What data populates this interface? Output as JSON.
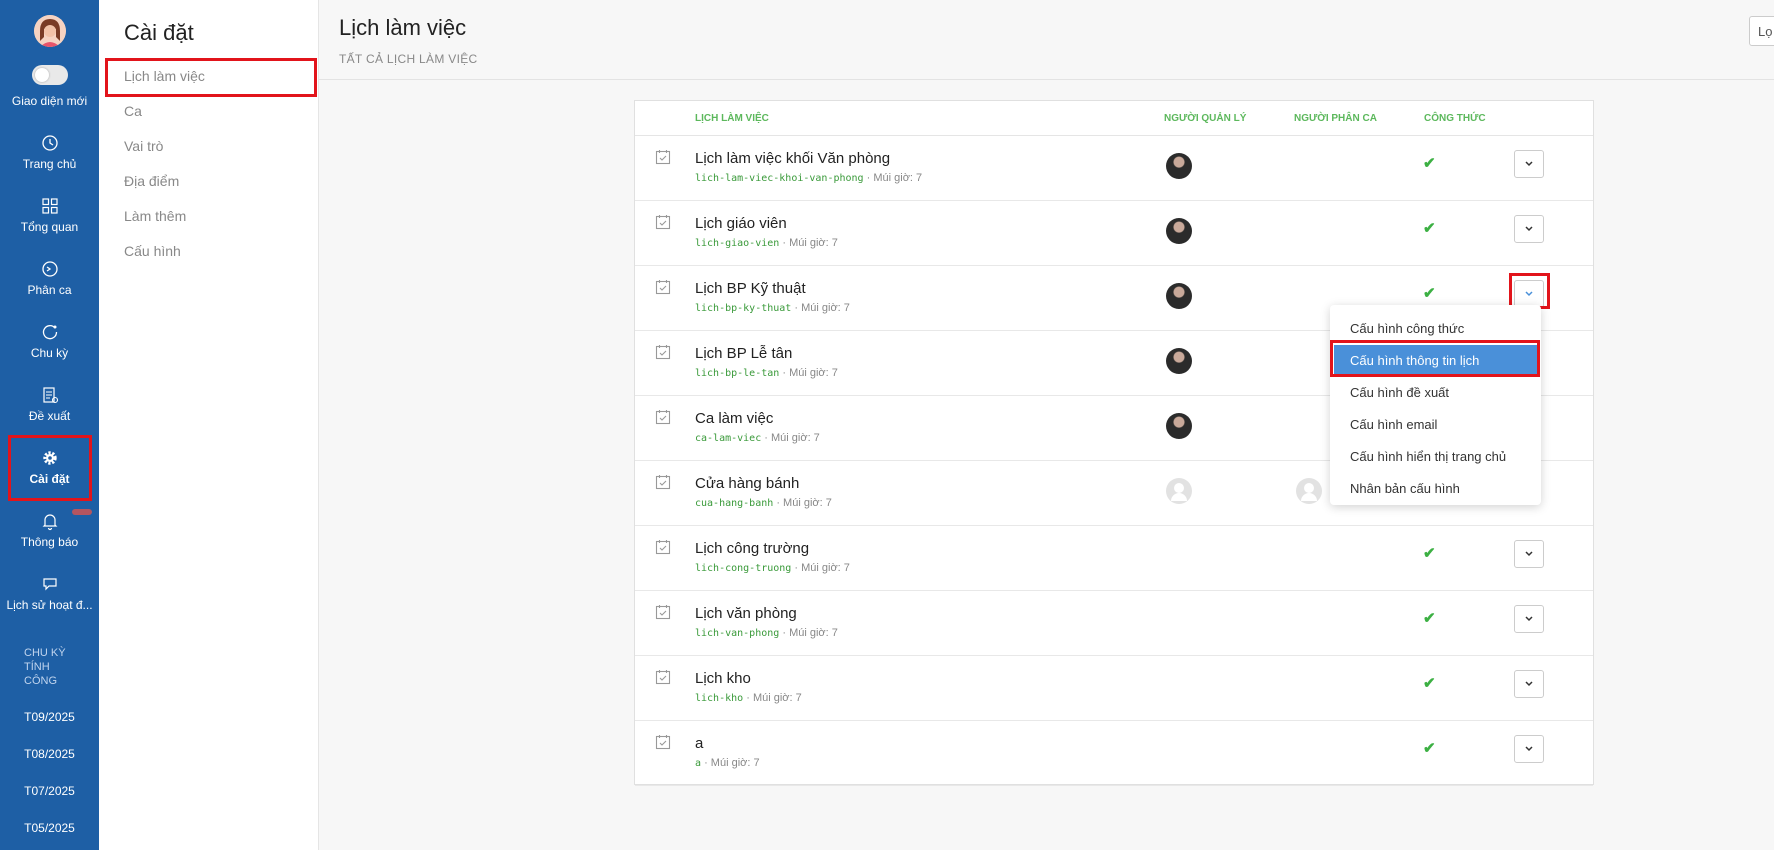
{
  "nav": {
    "toggle_label": "Giao diện mới",
    "items": [
      {
        "label": "Trang chủ",
        "icon": "clock-icon"
      },
      {
        "label": "Tổng quan",
        "icon": "grid-icon"
      },
      {
        "label": "Phân ca",
        "icon": "clock-circle-icon"
      },
      {
        "label": "Chu kỳ",
        "icon": "refresh-icon"
      },
      {
        "label": "Đề xuất",
        "icon": "document-icon"
      },
      {
        "label": "Cài đặt",
        "icon": "gear-icon"
      },
      {
        "label": "Thông báo",
        "icon": "bell-icon"
      },
      {
        "label": "Lịch sử hoạt đ...",
        "icon": "chat-icon"
      }
    ],
    "cycle_title": "CHU KỲ TÍNH CÔNG",
    "cycles": [
      "T09/2025",
      "T08/2025",
      "T07/2025",
      "T05/2025"
    ]
  },
  "settings": {
    "title": "Cài đặt",
    "menu": [
      "Lịch làm việc",
      "Ca",
      "Vai trò",
      "Địa điểm",
      "Làm thêm",
      "Cấu hình"
    ]
  },
  "header": {
    "title": "Lịch làm việc",
    "subtitle": "TẤT CẢ LỊCH LÀM VIỆC",
    "top_button": "Lọ"
  },
  "table": {
    "columns": [
      "LỊCH LÀM VIỆC",
      "NGƯỜI QUẢN LÝ",
      "NGƯỜI PHÂN CA",
      "CÔNG THỨC"
    ],
    "rows": [
      {
        "name": "Lịch làm việc khối Văn phòng",
        "slug": "lich-lam-viec-khoi-van-phong",
        "tz": " · Múi giờ: 7",
        "manager": "photo",
        "formula": "✔"
      },
      {
        "name": "Lịch giáo viên",
        "slug": "lich-giao-vien",
        "tz": " · Múi giờ: 7",
        "manager": "photo",
        "formula": "✔"
      },
      {
        "name": "Lịch BP Kỹ thuật",
        "slug": "lich-bp-ky-thuat",
        "tz": " · Múi giờ: 7",
        "manager": "photo",
        "formula": "✔"
      },
      {
        "name": "Lịch BP Lễ tân",
        "slug": "lich-bp-le-tan",
        "tz": " · Múi giờ: 7",
        "manager": "photo",
        "formula": ""
      },
      {
        "name": "Ca làm việc",
        "slug": "ca-lam-viec",
        "tz": " · Múi giờ: 7",
        "manager": "photo",
        "formula": ""
      },
      {
        "name": "Cửa hàng bánh",
        "slug": "cua-hang-banh",
        "tz": " · Múi giờ: 7",
        "manager": "blank",
        "formula": ""
      },
      {
        "name": "Lịch công trường",
        "slug": "lich-cong-truong",
        "tz": " · Múi giờ: 7",
        "manager": "",
        "formula": "✔"
      },
      {
        "name": "Lịch văn phòng",
        "slug": "lich-van-phong",
        "tz": " · Múi giờ: 7",
        "manager": "",
        "formula": "✔"
      },
      {
        "name": "Lịch kho",
        "slug": "lich-kho",
        "tz": " · Múi giờ: 7",
        "manager": "",
        "formula": "✔"
      },
      {
        "name": "a",
        "slug": "a",
        "tz": " · Múi giờ: 7",
        "manager": "",
        "formula": "✔"
      }
    ]
  },
  "dropdown": {
    "items": [
      "Cấu hình công thức",
      "Cấu hình thông tin lịch",
      "Cấu hình đề xuất",
      "Cấu hình email",
      "Cấu hình hiển thị trang chủ",
      "Nhân bản cấu hình"
    ],
    "highlighted": "Cấu hình thông tin lịch"
  },
  "colors": {
    "nav_bg": "#1e5fa5",
    "accent_green": "#5cb85c",
    "highlight_blue": "#4a90d9",
    "annotation_red": "#e2141b"
  }
}
